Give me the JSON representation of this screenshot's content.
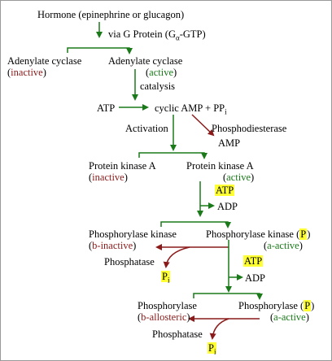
{
  "colors": {
    "active_green": "#1a7a1a",
    "inactive_red": "#8b1a1a",
    "highlight_yellow": "#ffff33"
  },
  "hormone": "Hormone (epinephrine or glucagon)",
  "g_protein": {
    "prefix": "via G Protein (G",
    "sub": "α",
    "suffix": "-GTP)"
  },
  "adenylate_cyclase_inactive": {
    "name": "Adenylate cyclase",
    "state": "inactive"
  },
  "adenylate_cyclase_active": {
    "name": "Adenylate cyclase",
    "state": "active"
  },
  "catalysis": "catalysis",
  "atp_1": "ATP",
  "camp": {
    "text": "cyclic AMP + PP",
    "sub": "i"
  },
  "activation": "Activation",
  "phosphodiesterase": "Phosphodiesterase",
  "amp": "AMP",
  "pka_inactive": {
    "name": "Protein kinase A",
    "state": "inactive"
  },
  "pka_active": {
    "name": "Protein kinase A",
    "state": "active"
  },
  "atp_2": "ATP",
  "adp_1": "ADP",
  "phk_inactive": {
    "name": "Phosphorylase kinase",
    "state": "b-inactive"
  },
  "phk_active": {
    "name": "Phosphorylase kinase",
    "p": "P",
    "state": "a-active"
  },
  "phosphatase_1": "Phosphatase",
  "pi_1": {
    "text": "P",
    "sub": "i"
  },
  "atp_3": "ATP",
  "adp_2": "ADP",
  "ph_allosteric": {
    "name": "Phosphorylase",
    "state": "b-allosteric"
  },
  "ph_active": {
    "name": "Phosphorylase",
    "p": "P",
    "state": "a-active"
  },
  "phosphatase_2": "Phosphatase",
  "pi_2": {
    "text": "P",
    "sub": "i"
  }
}
